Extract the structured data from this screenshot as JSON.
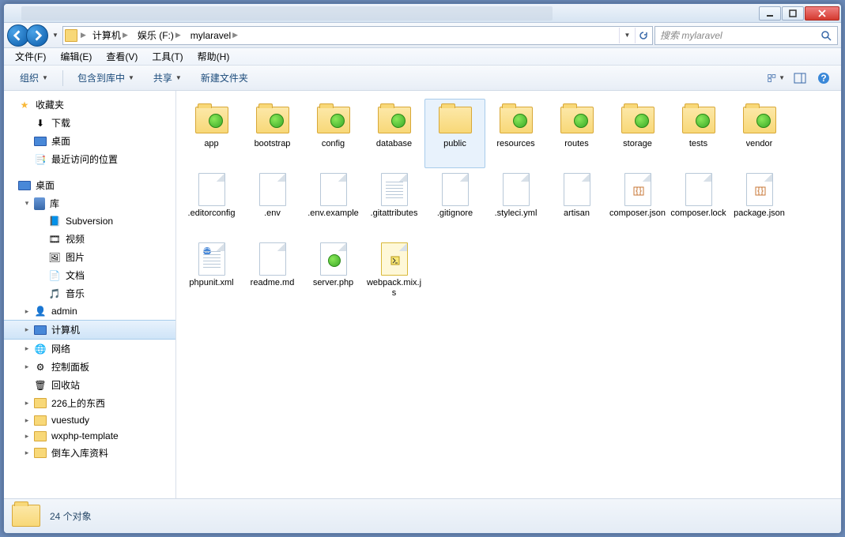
{
  "breadcrumb": {
    "seg0": "计算机",
    "seg1": "娱乐 (F:)",
    "seg2": "mylaravel"
  },
  "search": {
    "placeholder": "搜索 mylaravel"
  },
  "menu": {
    "file": "文件(F)",
    "edit": "编辑(E)",
    "view": "查看(V)",
    "tools": "工具(T)",
    "help": "帮助(H)"
  },
  "toolbar": {
    "organize": "组织",
    "include": "包含到库中",
    "share": "共享",
    "newfolder": "新建文件夹"
  },
  "sidebar": {
    "fav": "收藏夹",
    "downloads": "下载",
    "desktop": "桌面",
    "recent": "最近访问的位置",
    "desk": "桌面",
    "lib": "库",
    "svn": "Subversion",
    "video": "视频",
    "pic": "图片",
    "doc": "文档",
    "music": "音乐",
    "admin": "admin",
    "computer": "计算机",
    "network": "网络",
    "cpanel": "控制面板",
    "recycle": "回收站",
    "f1": "226上的东西",
    "f2": "vuestudy",
    "f3": "wxphp-template",
    "f4": "倒车入库资料"
  },
  "files": [
    {
      "n": "app",
      "t": "folder-dot"
    },
    {
      "n": "bootstrap",
      "t": "folder-dot"
    },
    {
      "n": "config",
      "t": "folder-dot"
    },
    {
      "n": "database",
      "t": "folder-dot"
    },
    {
      "n": "public",
      "t": "folder",
      "sel": true
    },
    {
      "n": "resources",
      "t": "folder-dot"
    },
    {
      "n": "routes",
      "t": "folder-dot"
    },
    {
      "n": "storage",
      "t": "folder-dot"
    },
    {
      "n": "tests",
      "t": "folder-dot"
    },
    {
      "n": "vendor",
      "t": "folder-dot"
    },
    {
      "n": ".editorconfig",
      "t": "file"
    },
    {
      "n": ".env",
      "t": "file"
    },
    {
      "n": ".env.example",
      "t": "file"
    },
    {
      "n": ".gitattributes",
      "t": "file-lines"
    },
    {
      "n": ".gitignore",
      "t": "file"
    },
    {
      "n": ".styleci.yml",
      "t": "file"
    },
    {
      "n": "artisan",
      "t": "file"
    },
    {
      "n": "composer.json",
      "t": "file-code"
    },
    {
      "n": "composer.lock",
      "t": "file"
    },
    {
      "n": "package.json",
      "t": "file-code"
    },
    {
      "n": "phpunit.xml",
      "t": "file-xml"
    },
    {
      "n": "readme.md",
      "t": "file"
    },
    {
      "n": "server.php",
      "t": "file-dot"
    },
    {
      "n": "webpack.mix.js",
      "t": "file-script"
    }
  ],
  "status": {
    "count": "24 个对象"
  }
}
